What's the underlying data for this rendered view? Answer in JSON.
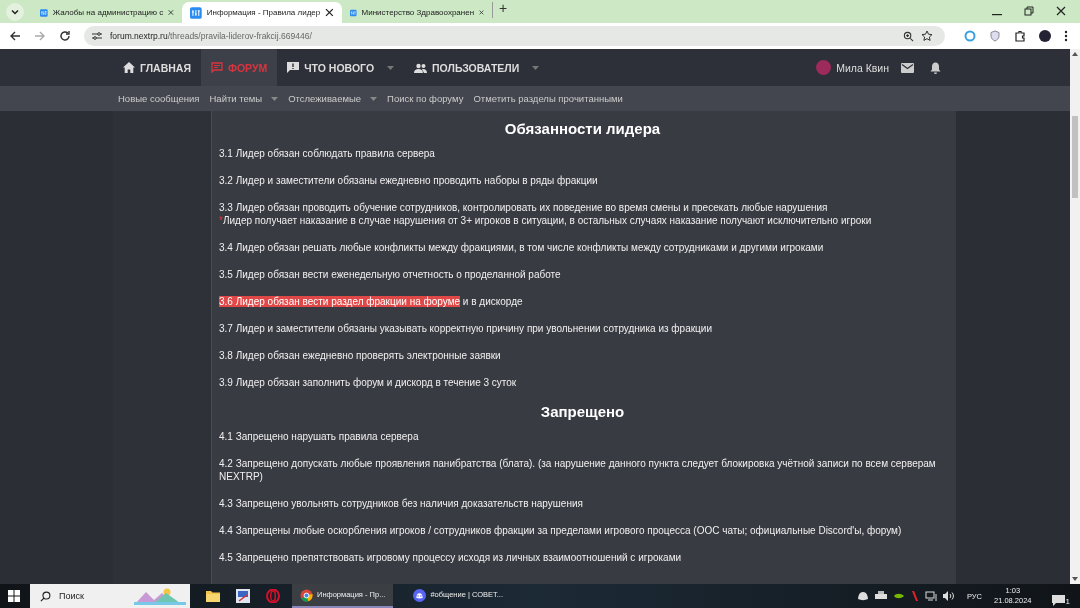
{
  "browser": {
    "tabs": [
      {
        "title": "Жалобы на администрацию с",
        "selected": false
      },
      {
        "title": "Информация - Правила лидер",
        "selected": true
      },
      {
        "title": "Министерство Здравоохранен",
        "selected": false
      }
    ],
    "new_tab": "+",
    "url": {
      "host": "forum.nextrp.ru",
      "path": "/threads/pravila-liderov-frakcij.669446/"
    }
  },
  "nav": {
    "items": [
      {
        "label": "ГЛАВНАЯ",
        "kind": "home",
        "dropdown": false,
        "selected": false
      },
      {
        "label": "ФОРУМ",
        "kind": "chat",
        "dropdown": false,
        "selected": true
      },
      {
        "label": "ЧТО НОВОГО",
        "kind": "alert",
        "dropdown": true,
        "selected": false
      },
      {
        "label": "ПОЛЬЗОВАТЕЛИ",
        "kind": "users",
        "dropdown": true,
        "selected": false
      }
    ],
    "user": "Мила Квин"
  },
  "subnav": [
    {
      "label": "Новые сообщения",
      "dropdown": false
    },
    {
      "label": "Найти темы",
      "dropdown": true
    },
    {
      "label": "Отслеживаемые",
      "dropdown": true
    },
    {
      "label": "Поиск по форуму",
      "dropdown": false
    },
    {
      "label": "Отметить разделы прочитанными",
      "dropdown": false
    }
  ],
  "sections": [
    {
      "heading": "Обязанности лидера",
      "rules": [
        {
          "text": "3.1 Лидер обязан соблюдать правила сервера"
        },
        {
          "text": "3.2 Лидер и заместители обязаны ежедневно проводить наборы в ряды фракции"
        },
        {
          "text": "3.3 Лидер обязан проводить обучение сотрудников, контролировать их поведение во время смены и пресекать любые нарушения",
          "note_mark": "*",
          "note": "Лидер получает наказание в случае нарушения от 3+ игроков в ситуации, в остальных случаях наказание получают исключительно игроки"
        },
        {
          "text": "3.4 Лидер обязан решать любые конфликты между фракциями, в том числе конфликты между сотрудниками и другими игроками"
        },
        {
          "text": "3.5 Лидер обязан вести еженедельную отчетность о проделанной работе"
        },
        {
          "highlight": "3.6 Лидер обязан вести раздел фракции на форуме",
          "text": " и в дискорде"
        },
        {
          "text": "3.7 Лидер и заместители обязаны указывать корректную причину при увольнении сотрудника из фракции"
        },
        {
          "text": "3.8 Лидер обязан ежедневно проверять электронные заявки"
        },
        {
          "text": "3.9 Лидер обязан заполнить форум и дискорд в течение 3 суток"
        }
      ]
    },
    {
      "heading": "Запрещено",
      "rules": [
        {
          "text": "4.1 Запрещено нарушать правила сервера"
        },
        {
          "text": "4.2 Запрещено допускать любые проявления панибратства (блата). (за нарушение данного пункта следует блокировка учётной записи по всем серверам NEXTRP)"
        },
        {
          "text": "4.3 Запрещено увольнять сотрудников без наличия доказательств нарушения"
        },
        {
          "text": "4.4 Запрещены любые оскорбления игроков / сотрудников фракции за пределами игрового процесса (OOC чаты; официальные Discord'ы, форум)"
        },
        {
          "text": "4.5 Запрещено препятствовать игровому процессу исходя из личных взаимоотношений с игроками"
        }
      ]
    }
  ],
  "taskbar": {
    "search_placeholder": "Поиск",
    "apps": [
      {
        "label": "Информация - Пр...",
        "kind": "chrome",
        "selected": true
      },
      {
        "label": "#общение | СОВЕТ...",
        "kind": "discord",
        "selected": false
      }
    ],
    "lang": "РУС",
    "time": "1:03",
    "date": "21.08.2024",
    "notifications": "1"
  }
}
